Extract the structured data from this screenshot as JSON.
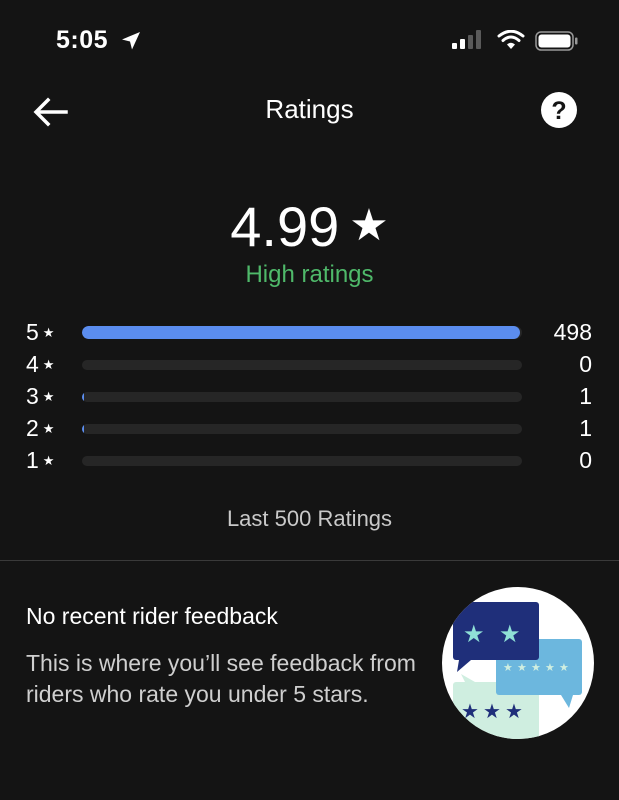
{
  "status_bar": {
    "time": "5:05",
    "location_icon": "location-arrow-icon",
    "signal_icon": "cellular-signal-icon",
    "wifi_icon": "wifi-icon",
    "battery_icon": "battery-icon"
  },
  "header": {
    "title": "Ratings",
    "back_icon": "back-arrow-icon",
    "help_icon": "help-icon"
  },
  "summary": {
    "rating": "4.99",
    "star": "★",
    "label": "High ratings"
  },
  "distribution": [
    {
      "stars": "5",
      "count": "498",
      "fraction": 0.996
    },
    {
      "stars": "4",
      "count": "0",
      "fraction": 0
    },
    {
      "stars": "3",
      "count": "1",
      "fraction": 0.004
    },
    {
      "stars": "2",
      "count": "1",
      "fraction": 0.004
    },
    {
      "stars": "1",
      "count": "0",
      "fraction": 0
    }
  ],
  "distribution_star": "★",
  "footer_note": "Last 500 Ratings",
  "feedback": {
    "title": "No recent rider feedback",
    "body": "This is where you’ll see feedback from riders who rate you under 5 stars."
  },
  "colors": {
    "background": "#141414",
    "accent_green": "#4fb96a",
    "bar_blue": "#5b8def"
  }
}
